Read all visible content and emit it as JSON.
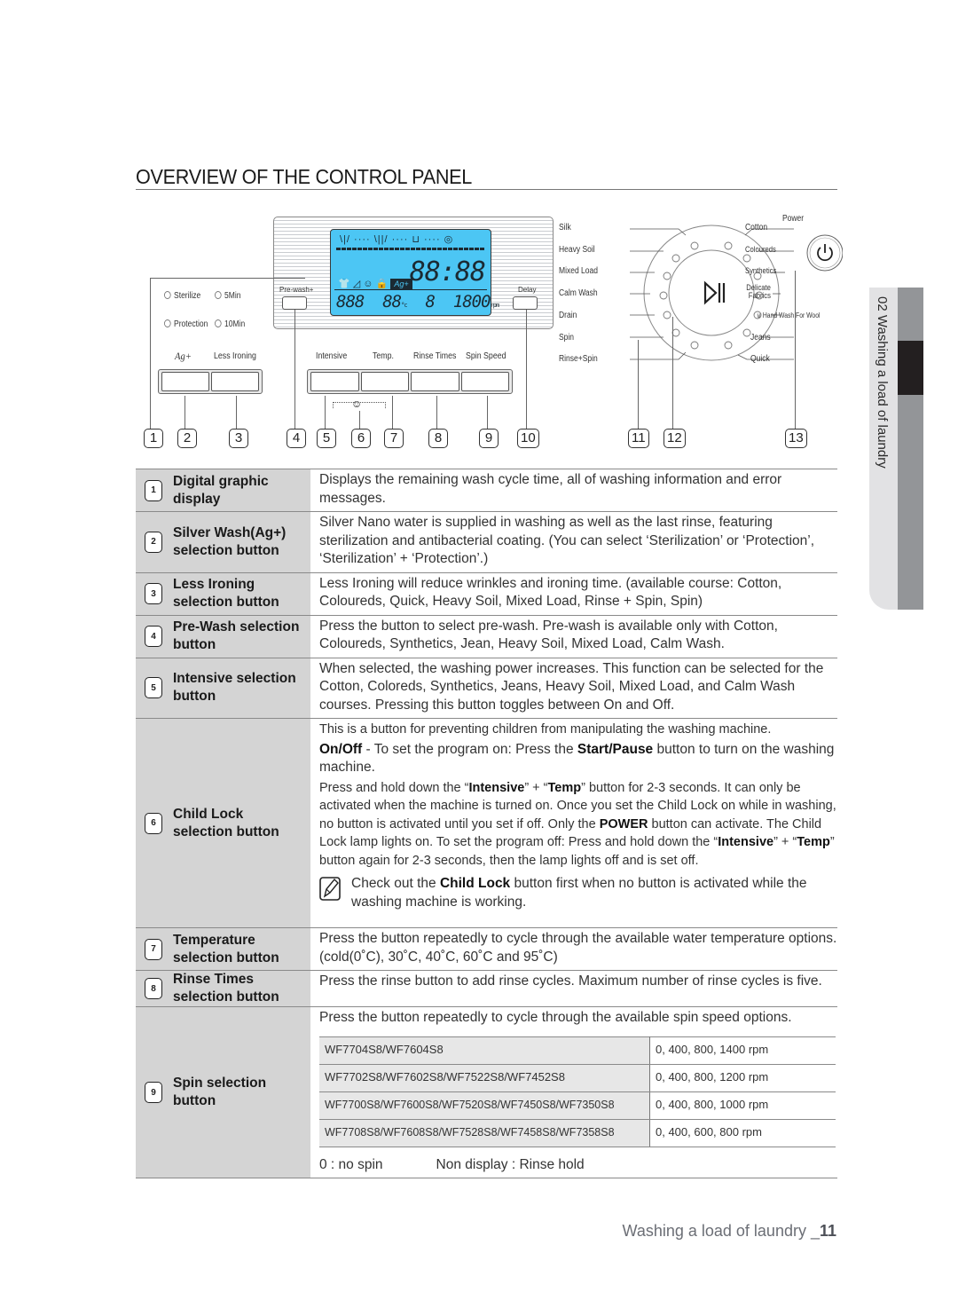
{
  "title": "OVERVIEW OF THE CONTROL PANEL",
  "side_tab": {
    "label": "02 Washing a load of laundry"
  },
  "diagram": {
    "silver_options": [
      {
        "left": "Sterilize",
        "right": "5Min"
      },
      {
        "left": "Protection",
        "right": "10Min"
      }
    ],
    "ag_label": "Ag+",
    "less_ironing_label": "Less Ironing",
    "prewash_label": "Pre-wash+",
    "delay_label": "Delay",
    "function_labels": [
      "Intensive",
      "Temp.",
      "Rinse Times",
      "Spin Speed"
    ],
    "lcd": {
      "stages": "\\|/ ···· \\||/ ···· ⊔ ···· ◎",
      "time": "88:88",
      "status_icons": "👕 ◿ ☺ 🔒",
      "ag_indicator": "Ag+",
      "row3_a": "888",
      "row3_b": "88",
      "row3_b_unit": "°c",
      "row3_c": "8",
      "row3_d": "1800",
      "row3_d_unit": "rpm"
    },
    "dial_left_labels": [
      "Silk",
      "Heavy Soil",
      "Mixed Load",
      "Calm Wash",
      "Drain",
      "Spin",
      "Rinse+Spin"
    ],
    "dial_right_labels": [
      "Cotton",
      "Coloureds",
      "Synthetics",
      "Delicate Fabrics",
      "Hand Wash For Wool",
      "Jeans",
      "Quick"
    ],
    "power_label": "Power",
    "callouts": [
      "1",
      "2",
      "3",
      "4",
      "5",
      "6",
      "7",
      "8",
      "9",
      "10",
      "11",
      "12",
      "13"
    ]
  },
  "table": [
    {
      "num": "1",
      "name": "Digital graphic display",
      "desc": "Displays the remaining wash cycle time, all of washing information and error messages."
    },
    {
      "num": "2",
      "name": "Silver Wash(Ag+) selection button",
      "desc": "Silver Nano water is supplied in washing as well as the last rinse, featuring sterilization and antibacterial coating. (You can select ‘Sterilization’ or ‘Protection’, ‘Sterilization’ + ‘Protection’.)"
    },
    {
      "num": "3",
      "name": "Less Ironing selection button",
      "desc": "Less Ironing will reduce wrinkles and ironing time. (available course: Cotton, Coloureds, Quick, Heavy Soil, Mixed Load, Rinse + Spin, Spin)"
    },
    {
      "num": "4",
      "name": "Pre-Wash selection button",
      "desc": "Press the button to select pre-wash. Pre-wash is available only with Cotton, Coloureds, Synthetics, Jean, Heavy Soil, Mixed Load, Calm Wash."
    },
    {
      "num": "5",
      "name": "Intensive selection button",
      "desc": "When selected, the washing power increases. This function can be selected for the Cotton, Coloreds, Synthetics, Jeans, Heavy Soil, Mixed Load, and Calm Wash courses. Pressing this button toggles between On and Off."
    },
    {
      "num": "6",
      "name": "Child Lock selection button",
      "desc_intro": "This is a button for preventing children from manipulating the washing machine.",
      "onoff_bold": "On/Off",
      "onoff_text1": " - To set the program on: Press the ",
      "onoff_bold2": "Start/Pause",
      "onoff_text2": " button to turn on the washing machine.",
      "hold_p1": "Press and hold down the “",
      "hold_b1": "Intensive",
      "hold_p2": "” + “",
      "hold_b2": "Temp",
      "hold_p3": "” button for 2-3 seconds. It can only be activated when the machine is turned on. Once you set the Child Lock on while in washing, no button is activated until you set if off. Only the ",
      "hold_b3": "POWER",
      "hold_p4": " button can activate. The Child Lock lamp lights on. To set the program off: Press and hold down the “",
      "hold_b4": "Intensive",
      "hold_p5": "” + “",
      "hold_b5": "Temp",
      "hold_p6": "” button again for 2-3 seconds, then the lamp lights off and is set off.",
      "note_p1": "Check out the ",
      "note_b": "Child Lock",
      "note_p2": " button first when no button is activated while the washing machine is working."
    },
    {
      "num": "7",
      "name": "Temperature selection button",
      "desc": "Press the button repeatedly to cycle through the available water temperature options. (cold(0˚C), 30˚C, 40˚C, 60˚C and 95˚C)"
    },
    {
      "num": "8",
      "name": "Rinse Times selection button",
      "desc": "Press the rinse button to add rinse cycles. Maximum number of rinse cycles is five."
    },
    {
      "num": "9",
      "name": "Spin selection button",
      "desc": "Press the button repeatedly to cycle through the available spin speed options.",
      "spin_rows": [
        {
          "models": "WF7704S8/WF7604S8",
          "speeds": "0, 400, 800, 1400 rpm"
        },
        {
          "models": "WF7702S8/WF7602S8/WF7522S8/WF7452S8",
          "speeds": "0, 400, 800, 1200 rpm"
        },
        {
          "models": "WF7700S8/WF7600S8/WF7520S8/WF7450S8/WF7350S8",
          "speeds": "0, 400, 800, 1000 rpm"
        },
        {
          "models": "WF7708S8/WF7608S8/WF7528S8/WF7458S8/WF7358S8",
          "speeds": "0, 400, 600, 800 rpm"
        }
      ],
      "foot_a": "0 : no spin",
      "foot_b": "Non display : Rinse hold"
    }
  ],
  "footer": {
    "text": "Washing a load of laundry _",
    "page": "11"
  }
}
